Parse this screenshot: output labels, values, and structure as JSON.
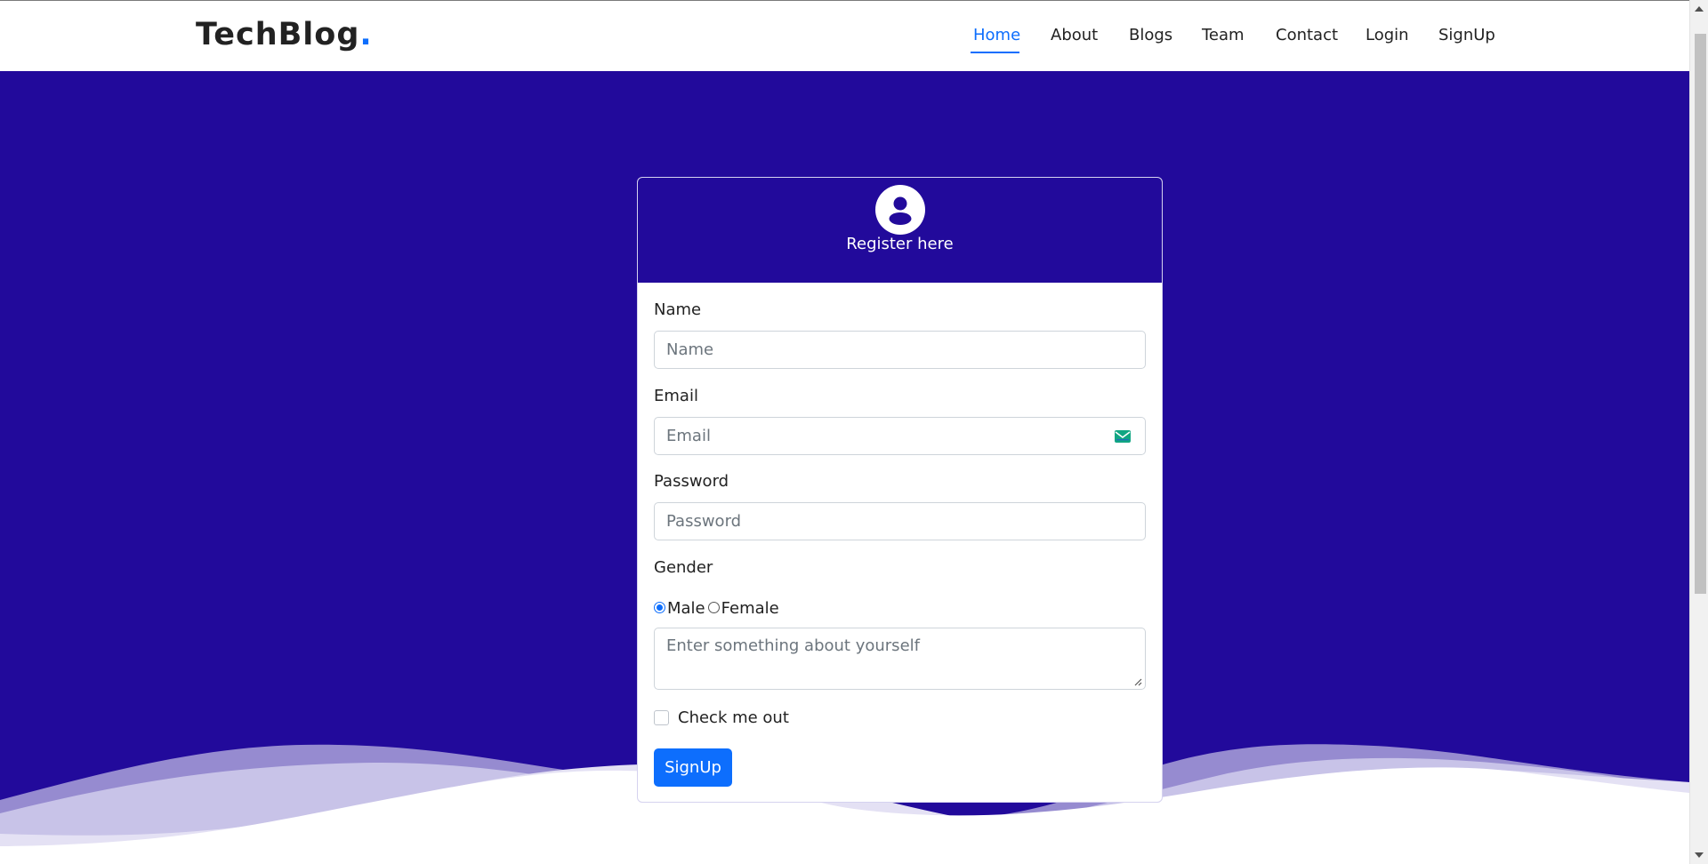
{
  "brand": {
    "name": "TechBlog",
    "dot": "."
  },
  "nav": {
    "items": [
      {
        "label": "Home",
        "active": true
      },
      {
        "label": "About"
      },
      {
        "label": "Blogs"
      },
      {
        "label": "Team"
      },
      {
        "label": "Contact"
      },
      {
        "label": "Login"
      },
      {
        "label": "SignUp"
      }
    ]
  },
  "form": {
    "header_title": "Register here",
    "name": {
      "label": "Name",
      "placeholder": "Name"
    },
    "email": {
      "label": "Email",
      "placeholder": "Email"
    },
    "password": {
      "label": "Password",
      "placeholder": "Password"
    },
    "gender": {
      "label": "Gender",
      "options": [
        "Male",
        "Female"
      ],
      "selected": "Male"
    },
    "about": {
      "placeholder": "Enter something about yourself"
    },
    "checkbox": {
      "label": "Check me out",
      "checked": false
    },
    "submit_label": "SignUp"
  },
  "icons": {
    "avatar": "user-circle-icon",
    "email": "envelope-icon"
  },
  "colors": {
    "primary": "#0d6efd",
    "hero_bg": "#220a9b",
    "wave_light": "#e4e1f4"
  }
}
